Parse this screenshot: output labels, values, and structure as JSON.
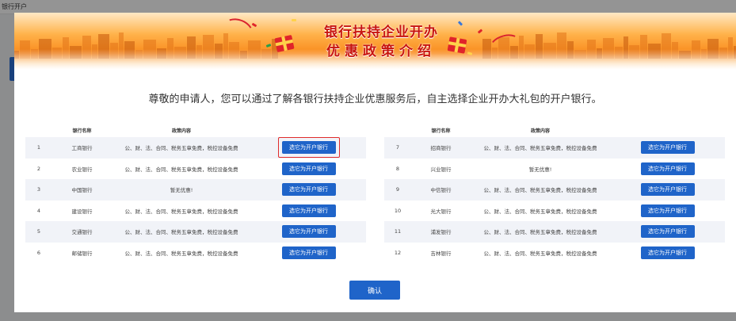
{
  "background": {
    "breadcrumb": "银行开户"
  },
  "banner": {
    "title": "银行扶持企业开办",
    "subtitle": "优惠政策介绍"
  },
  "intro": "尊敬的申请人，您可以通过了解各银行扶持企业优惠服务后，自主选择企业开办大礼包的开户银行。",
  "table": {
    "headers": {
      "index": "",
      "bank": "银行名称",
      "policy": "政策内容",
      "action": ""
    },
    "left": [
      {
        "idx": "1",
        "bank": "工商银行",
        "policy": "公、财、法、合同、税务五章免费，税控设备免费",
        "action": "选它为开户银行"
      },
      {
        "idx": "2",
        "bank": "农业银行",
        "policy": "公、财、法、合同、税务五章免费，税控设备免费",
        "action": "选它为开户银行"
      },
      {
        "idx": "3",
        "bank": "中国银行",
        "policy": "暂无优惠!",
        "action": "选它为开户银行"
      },
      {
        "idx": "4",
        "bank": "建设银行",
        "policy": "公、财、法、合同、税务五章免费，税控设备免费",
        "action": "选它为开户银行"
      },
      {
        "idx": "5",
        "bank": "交通银行",
        "policy": "公、财、法、合同、税务五章免费，税控设备免费",
        "action": "选它为开户银行"
      },
      {
        "idx": "6",
        "bank": "邮储银行",
        "policy": "公、财、法、合同、税务五章免费，税控设备免费",
        "action": "选它为开户银行"
      }
    ],
    "right": [
      {
        "idx": "7",
        "bank": "招商银行",
        "policy": "公、财、法、合同、税务五章免费，税控设备免费",
        "action": "选它为开户银行"
      },
      {
        "idx": "8",
        "bank": "兴业银行",
        "policy": "暂无优惠!",
        "action": "选它为开户银行"
      },
      {
        "idx": "9",
        "bank": "中信银行",
        "policy": "公、财、法、合同、税务五章免费，税控设备免费",
        "action": "选它为开户银行"
      },
      {
        "idx": "10",
        "bank": "光大银行",
        "policy": "公、财、法、合同、税务五章免费，税控设备免费",
        "action": "选它为开户银行"
      },
      {
        "idx": "11",
        "bank": "浦发银行",
        "policy": "公、财、法、合同、税务五章免费，税控设备免费",
        "action": "选它为开户银行"
      },
      {
        "idx": "12",
        "bank": "吉林银行",
        "policy": "公、财、法、合同、税务五章免费，税控设备免费",
        "action": "选它为开户银行"
      }
    ]
  },
  "confirm_label": "确认",
  "colors": {
    "primary": "#1f64c9",
    "highlight": "#e02b2b",
    "title": "#c8150f",
    "banner": "#f98a1c"
  },
  "icons": {
    "gift": "gift-icon"
  }
}
